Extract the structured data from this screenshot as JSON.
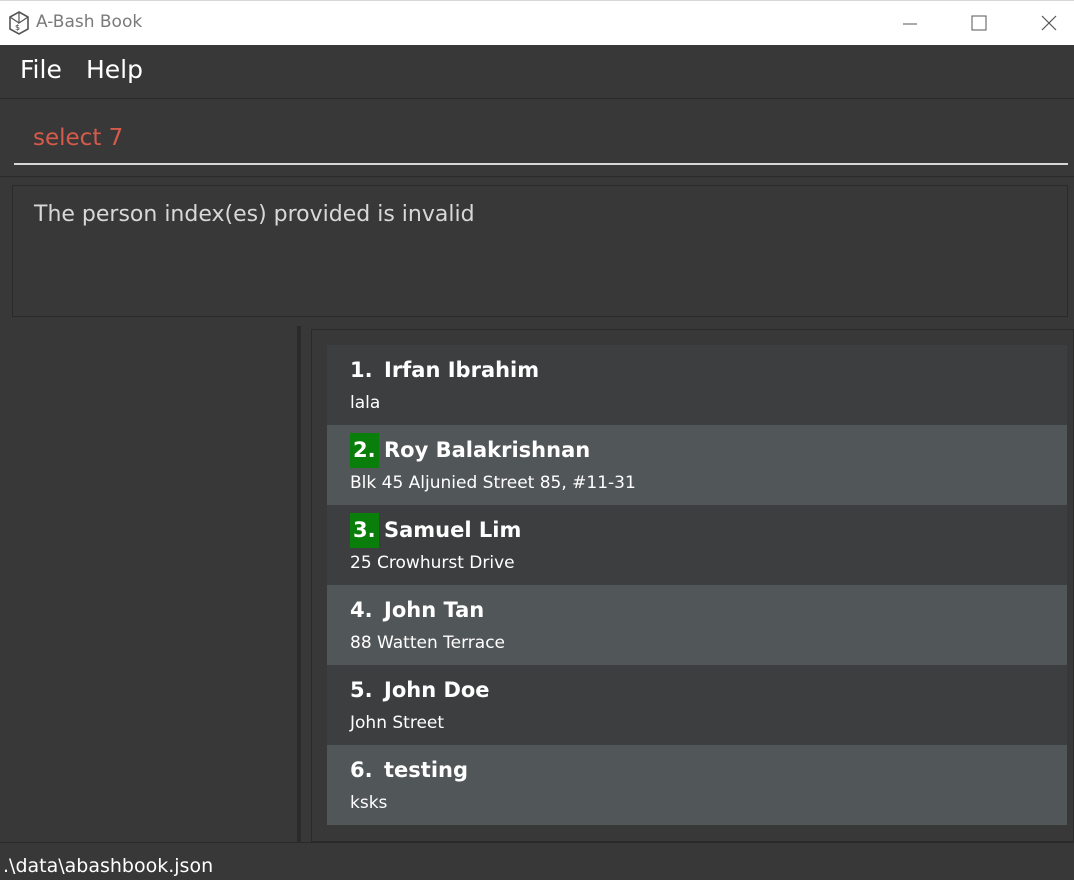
{
  "window": {
    "title": "A-Bash Book",
    "icons": [
      "app-logo-icon",
      "minimize-icon",
      "maximize-icon",
      "close-icon"
    ]
  },
  "menu": {
    "file_label": "File",
    "help_label": "Help"
  },
  "command": {
    "value": "select 7"
  },
  "result": {
    "message": "The person index(es) provided is invalid"
  },
  "persons": [
    {
      "index": "1.",
      "name": "Irfan Ibrahim",
      "address": "lala",
      "selected": false
    },
    {
      "index": "2.",
      "name": "Roy Balakrishnan",
      "address": "Blk 45 Aljunied Street 85, #11-31",
      "selected": true
    },
    {
      "index": "3.",
      "name": "Samuel Lim",
      "address": "25 Crowhurst Drive",
      "selected": true
    },
    {
      "index": "4.",
      "name": "John Tan",
      "address": "88 Watten Terrace",
      "selected": false
    },
    {
      "index": "5.",
      "name": "John Doe",
      "address": "John Street",
      "selected": false
    },
    {
      "index": "6.",
      "name": "testing",
      "address": "ksks",
      "selected": false
    }
  ],
  "status": {
    "file_path": ".\\data\\abashbook.json"
  },
  "colors": {
    "background": "#383838",
    "card_dark": "#3c3e3f",
    "card_light": "#515658",
    "selected_index": "#0a7e0a",
    "command_text": "#d65a4a"
  }
}
